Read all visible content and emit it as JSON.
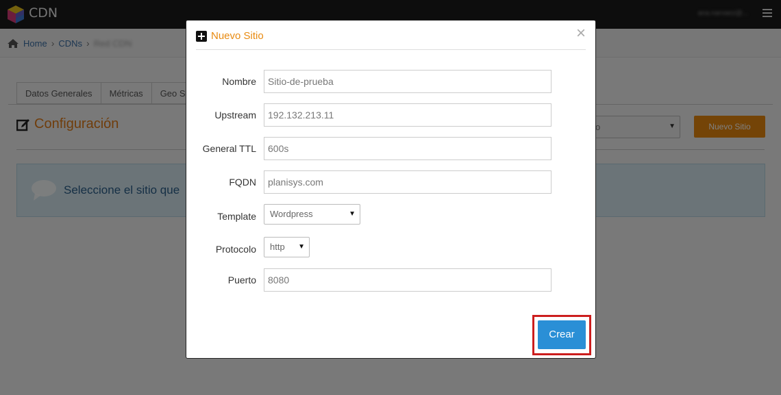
{
  "app": {
    "brand": "CDN",
    "user": "ana.narvaez@..."
  },
  "breadcrumb": {
    "home": "Home",
    "cdns": "CDNs",
    "current": "Red CDN"
  },
  "tabs": [
    "Datos Generales",
    "Métricas",
    "Geo S"
  ],
  "section": {
    "title": "Configuración"
  },
  "toolbar": {
    "select_value": "o",
    "new_site_label": "Nuevo Sitio"
  },
  "info": {
    "message": "Seleccione el sitio que"
  },
  "modal": {
    "title": "Nuevo Sitio",
    "close": "×",
    "fields": {
      "nombre_label": "Nombre",
      "nombre_value": "Sitio-de-prueba",
      "upstream_label": "Upstream",
      "upstream_value": "192.132.213.11",
      "ttl_label": "General TTL",
      "ttl_value": "600s",
      "fqdn_label": "FQDN",
      "fqdn_value": "planisys.com",
      "template_label": "Template",
      "template_value": "Wordpress",
      "protocolo_label": "Protocolo",
      "protocolo_value": "http",
      "puerto_label": "Puerto",
      "puerto_value": "8080"
    },
    "submit_label": "Crear"
  },
  "colors": {
    "accent_orange": "#e8880e",
    "primary_blue": "#2a8fd6",
    "highlight_red": "#cc1d1d"
  },
  "icons": [
    "cube-logo-icon",
    "hamburger-icon",
    "home-icon",
    "edit-icon",
    "chat-bubble-icon",
    "plus-square-icon",
    "close-icon",
    "dropdown-arrow-icon"
  ]
}
